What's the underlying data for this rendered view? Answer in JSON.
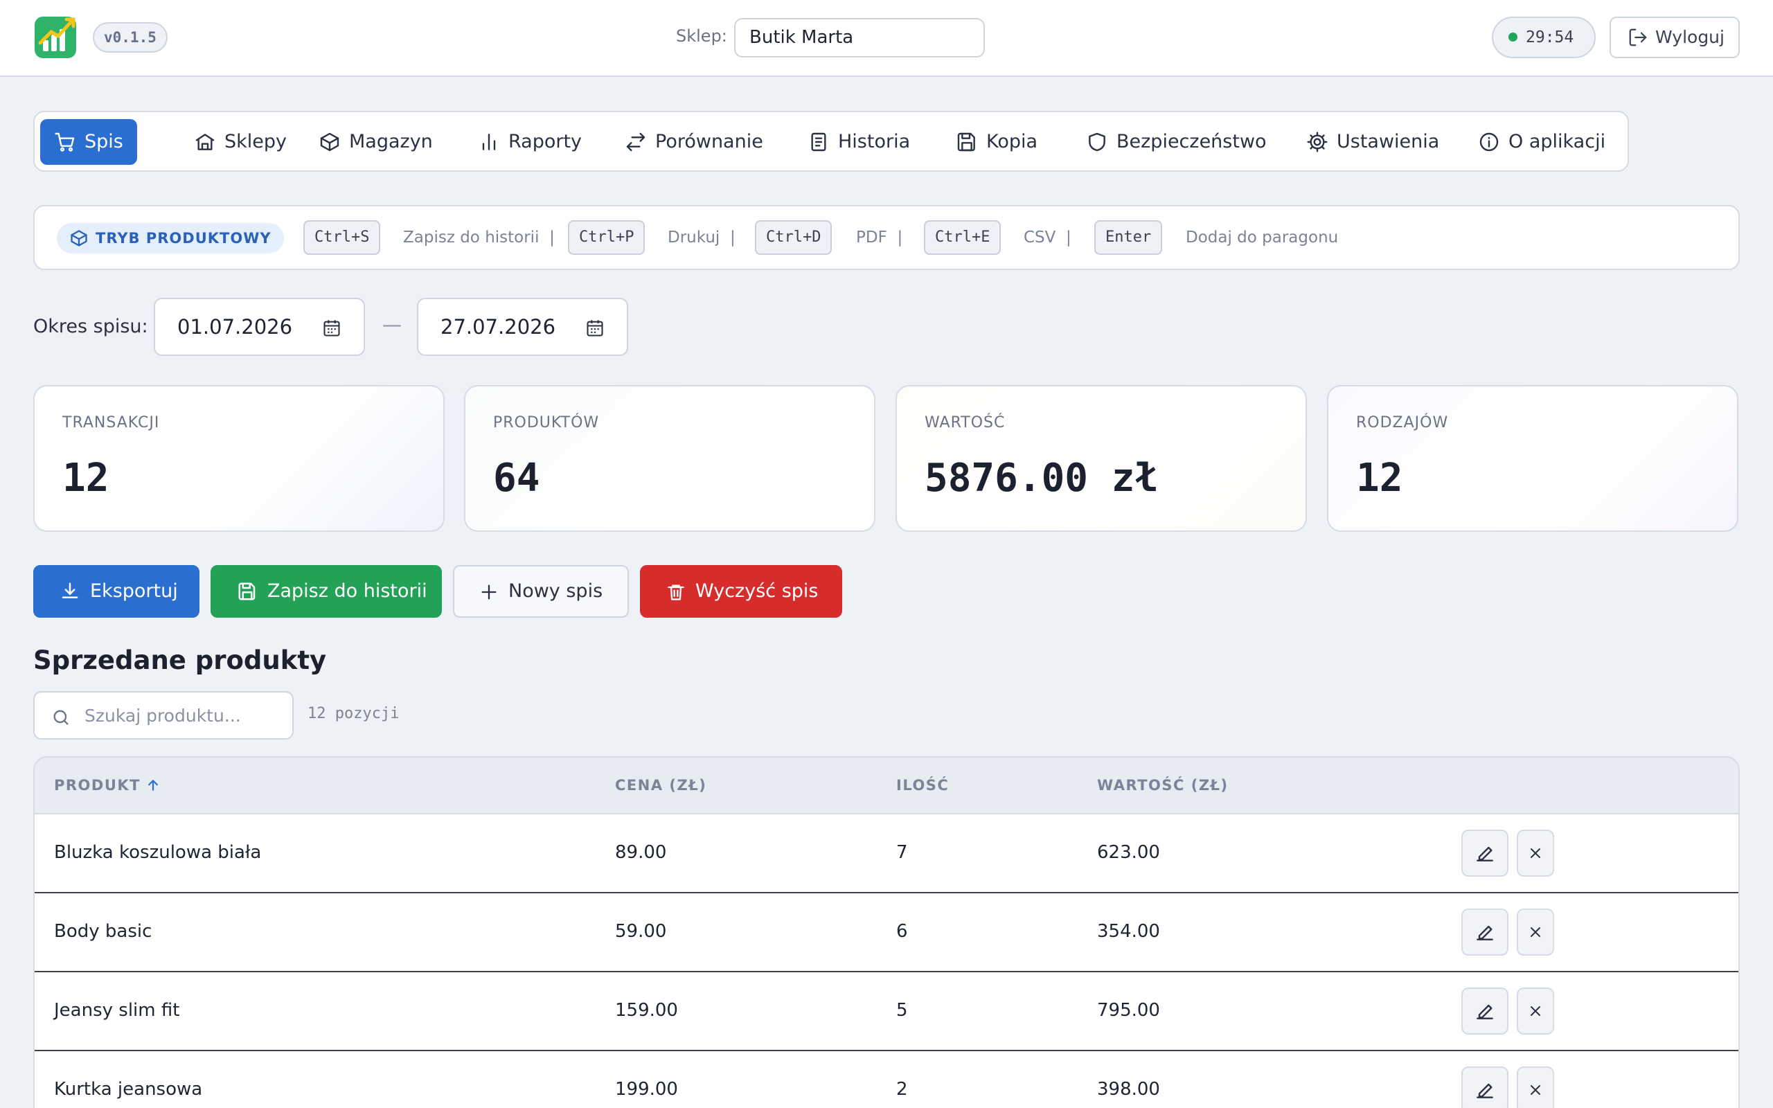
{
  "header": {
    "version": "v0.1.5",
    "shop_label": "Sklep:",
    "shop_value": "Butik Marta",
    "timer": "29:54",
    "logout_label": "Wyloguj"
  },
  "nav": {
    "items": [
      {
        "label": "Spis",
        "icon": "cart-icon",
        "active": true
      },
      {
        "label": "Sklepy",
        "icon": "store-icon"
      },
      {
        "label": "Magazyn",
        "icon": "box-icon"
      },
      {
        "label": "Raporty",
        "icon": "bar-chart-icon"
      },
      {
        "label": "Porównanie",
        "icon": "swap-icon"
      },
      {
        "label": "Historia",
        "icon": "document-icon"
      },
      {
        "label": "Kopia",
        "icon": "floppy-icon"
      },
      {
        "label": "Bezpieczeństwo",
        "icon": "shield-icon"
      },
      {
        "label": "Ustawienia",
        "icon": "gear-icon"
      },
      {
        "label": "O aplikacji",
        "icon": "info-icon"
      }
    ]
  },
  "shortcuts": {
    "mode": "TRYB PRODUKTOWY",
    "items": [
      {
        "key": "Ctrl+S",
        "label": "Zapisz do historii",
        "sep": "|"
      },
      {
        "key": "Ctrl+P",
        "label": "Drukuj",
        "sep": "|"
      },
      {
        "key": "Ctrl+D",
        "label": "PDF",
        "sep": "|"
      },
      {
        "key": "Ctrl+E",
        "label": "CSV",
        "sep": "|"
      },
      {
        "key": "Enter",
        "label": "Dodaj do paragonu",
        "sep": ""
      }
    ]
  },
  "period": {
    "label": "Okres spisu:",
    "from": "01.07.2026",
    "dash": "—",
    "to": "27.07.2026"
  },
  "stats": [
    {
      "label": "TRANSAKCJI",
      "value": "12"
    },
    {
      "label": "PRODUKTÓW",
      "value": "64"
    },
    {
      "label": "WARTOŚĆ",
      "value": "5876.00 zł"
    },
    {
      "label": "RODZAJÓW",
      "value": "12"
    }
  ],
  "actions": {
    "export": "Eksportuj",
    "save": "Zapisz do historii",
    "new": "Nowy spis",
    "clear": "Wyczyść spis"
  },
  "section_title": "Sprzedane produkty",
  "search": {
    "placeholder": "Szukaj produktu...",
    "value": ""
  },
  "count_text": "12 pozycji",
  "table": {
    "columns": [
      "PRODUKT",
      "CENA (ZŁ)",
      "ILOŚĆ",
      "WARTOŚĆ (ZŁ)"
    ],
    "rows": [
      {
        "product": "Bluzka koszulowa biała",
        "price": "89.00",
        "qty": "7",
        "value": "623.00"
      },
      {
        "product": "Body basic",
        "price": "59.00",
        "qty": "6",
        "value": "354.00"
      },
      {
        "product": "Jeansy slim fit",
        "price": "159.00",
        "qty": "5",
        "value": "795.00"
      },
      {
        "product": "Kurtka jeansowa",
        "price": "199.00",
        "qty": "2",
        "value": "398.00"
      }
    ]
  },
  "colors": {
    "primary": "#2a6fcf",
    "success": "#23a257",
    "danger": "#d72c2c",
    "background": "#eef1f6"
  }
}
